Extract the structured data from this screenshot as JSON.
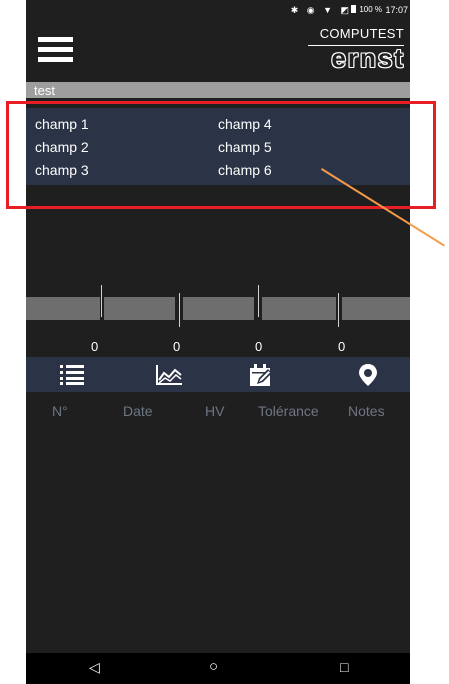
{
  "status_bar": {
    "icons": "✱ ◉ ▼ ◩",
    "battery": "100 %",
    "time": "17:07"
  },
  "header": {
    "brand_small": "COMPUTEST",
    "brand_big": "ernst"
  },
  "title": "test",
  "fields": [
    "champ 1",
    "champ 2",
    "champ 3",
    "champ 4",
    "champ 5",
    "champ 6"
  ],
  "counters": [
    "0",
    "0",
    "0",
    "0"
  ],
  "tabs": [
    {
      "label": "N°",
      "icon": "list-icon"
    },
    {
      "label": "Date",
      "icon": "chart-icon"
    },
    {
      "label": "HV",
      "icon": "calendar-edit-icon"
    },
    {
      "label": "Tolérance",
      "icon": "location-pin-icon"
    },
    {
      "label": "Notes",
      "icon": ""
    }
  ],
  "navigation": {
    "back": "◁",
    "home": "○",
    "recents": "□"
  },
  "colors": {
    "background": "#1f1f1f",
    "panel": "#2b3346",
    "titlebar": "#9e9e9e",
    "highlight_box": "#e81e25",
    "pointer_line": "#f39a4b",
    "tab_label": "#6f7684"
  }
}
